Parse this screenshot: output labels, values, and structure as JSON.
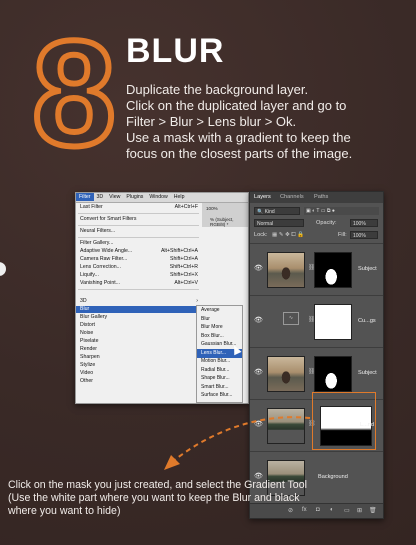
{
  "step": {
    "number": "8",
    "title": "BLUR"
  },
  "description": [
    "Duplicate the background layer.",
    "Click on the duplicated layer and go to",
    "Filter > Blur > Lens blur > Ok.",
    "Use a mask with a gradient to keep the",
    "focus on the closest parts of the image."
  ],
  "instruction": "Click on the mask you just created, and select the Gradient Tool (Use the white part where you want to keep the Blur and black where you want to hide)",
  "colors": {
    "accent": "#e07a2b",
    "background": "#3a2a27",
    "menu_highlight": "#2f62b8"
  },
  "ps_menu": {
    "menubar": [
      "Filter",
      "3D",
      "View",
      "Plugins",
      "Window",
      "Help"
    ],
    "active_menu": "Filter",
    "options": {
      "opacity": "100%",
      "doc_tab": "% (Subject, RGB/8) *"
    },
    "items": [
      {
        "label": "Last Filter",
        "shortcut": "Alt+Ctrl+F"
      },
      {
        "label": "Convert for Smart Filters",
        "shortcut": ""
      },
      {
        "label": "Neural Filters...",
        "shortcut": ""
      },
      {
        "label": "Filter Gallery...",
        "shortcut": ""
      },
      {
        "label": "Adaptive Wide Angle...",
        "shortcut": "Alt+Shift+Ctrl+A"
      },
      {
        "label": "Camera Raw Filter...",
        "shortcut": "Shift+Ctrl+A"
      },
      {
        "label": "Lens Correction...",
        "shortcut": "Shift+Ctrl+R"
      },
      {
        "label": "Liquify...",
        "shortcut": "Shift+Ctrl+X"
      },
      {
        "label": "Vanishing Point...",
        "shortcut": "Alt+Ctrl+V"
      },
      {
        "label": "3D",
        "shortcut": ""
      },
      {
        "label": "Blur",
        "shortcut": ""
      },
      {
        "label": "Blur Gallery",
        "shortcut": ""
      },
      {
        "label": "Distort",
        "shortcut": ""
      },
      {
        "label": "Noise",
        "shortcut": ""
      },
      {
        "label": "Pixelate",
        "shortcut": ""
      },
      {
        "label": "Render",
        "shortcut": ""
      },
      {
        "label": "Sharpen",
        "shortcut": ""
      },
      {
        "label": "Stylize",
        "shortcut": ""
      },
      {
        "label": "Video",
        "shortcut": ""
      },
      {
        "label": "Other",
        "shortcut": ""
      }
    ],
    "submenu": [
      "Average",
      "Blur",
      "Blur More",
      "Box Blur...",
      "Gaussian Blur...",
      "Lens Blur...",
      "Motion Blur...",
      "Radial Blur...",
      "Shape Blur...",
      "Smart Blur...",
      "Surface Blur..."
    ]
  },
  "layers_panel": {
    "tabs": [
      "Layers",
      "Channels",
      "Paths"
    ],
    "kind": "Kind",
    "blend_mode": "Normal",
    "opacity_label": "Opacity:",
    "opacity_value": "100%",
    "lock_label": "Lock:",
    "fill_label": "Fill:",
    "fill_value": "100%",
    "layers": [
      {
        "name": "Subject"
      },
      {
        "name": "Cu...gs"
      },
      {
        "name": "Subject"
      },
      {
        "name": "L...nd"
      },
      {
        "name": "Background"
      }
    ],
    "bottom_icons": [
      "link-icon",
      "fx-icon",
      "mask-icon",
      "adjustment-icon",
      "folder-icon",
      "new-layer-icon",
      "trash-icon"
    ],
    "bottom_glyphs": [
      "⊘",
      "fx",
      "◘",
      "◐",
      "▭",
      "⊞",
      "🗑"
    ]
  }
}
